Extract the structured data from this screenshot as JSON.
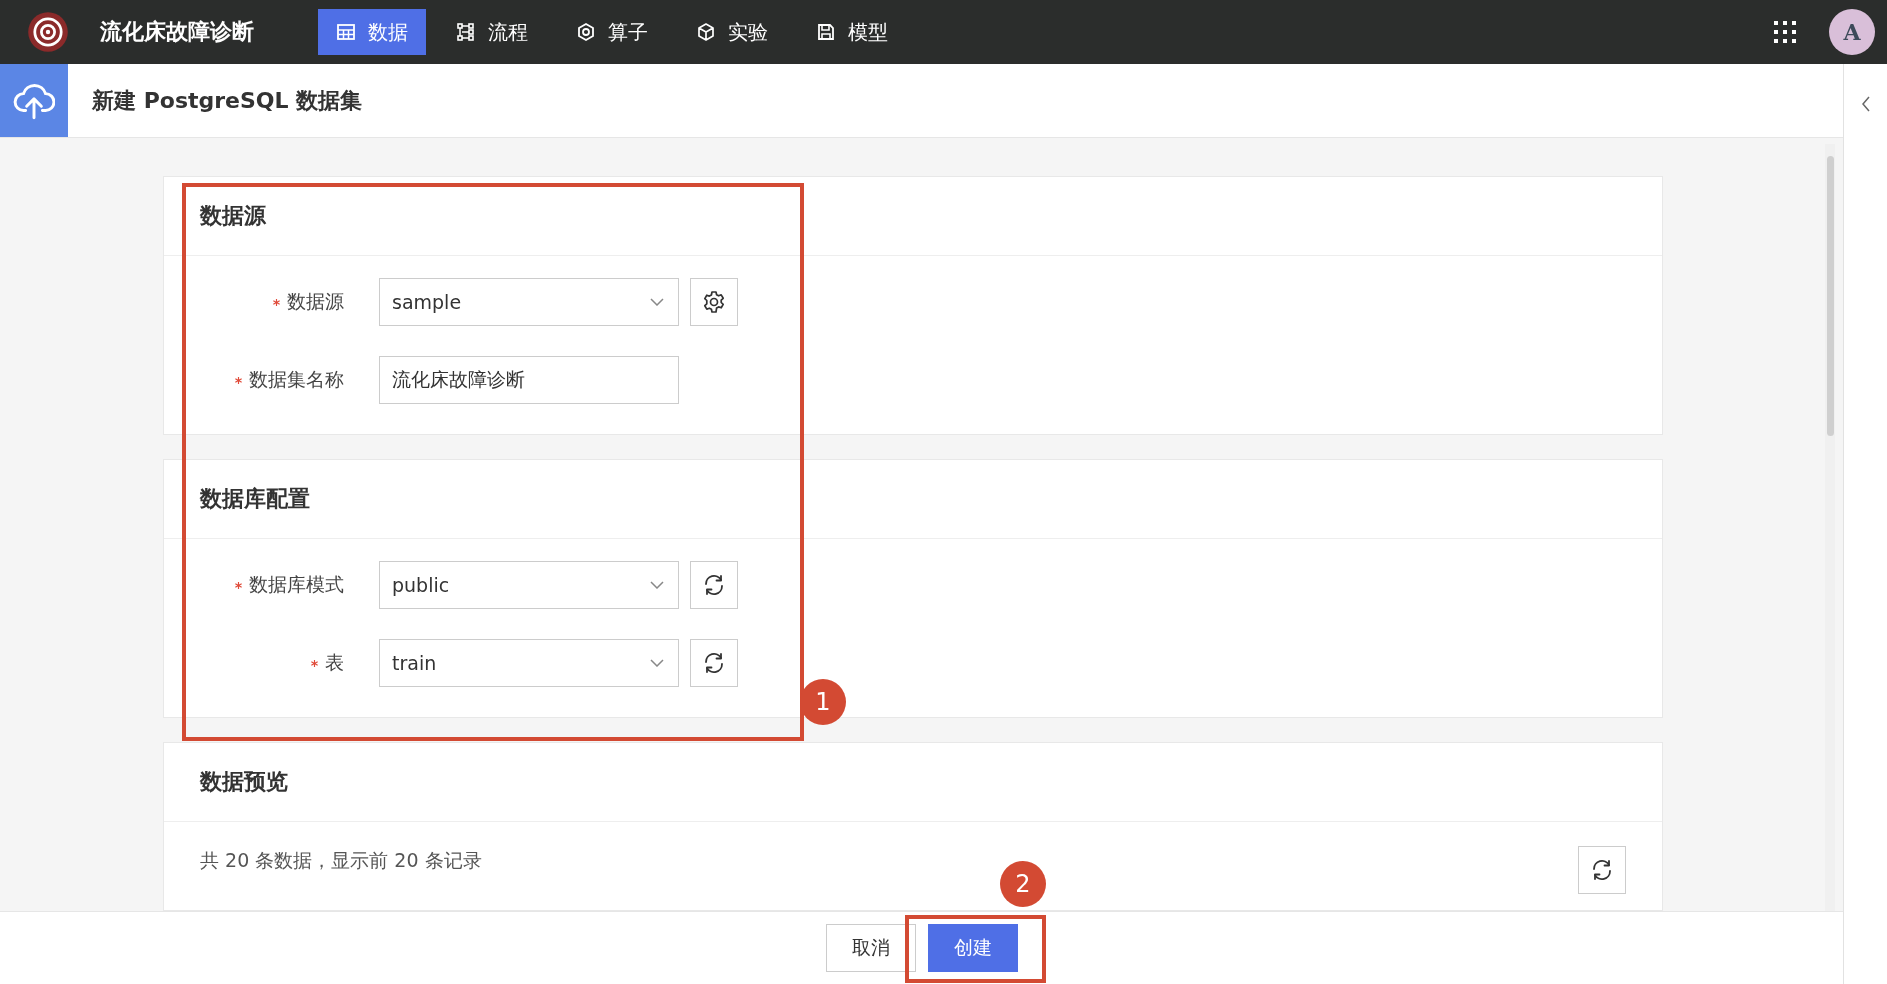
{
  "app": {
    "title": "流化床故障诊断",
    "avatar": "A",
    "nav": [
      {
        "label": "数据",
        "selected": true
      },
      {
        "label": "流程",
        "selected": false
      },
      {
        "label": "算子",
        "selected": false
      },
      {
        "label": "实验",
        "selected": false
      },
      {
        "label": "模型",
        "selected": false
      }
    ]
  },
  "page": {
    "title": "新建 PostgreSQL 数据集"
  },
  "sections": [
    {
      "title": "数据源",
      "fields": [
        {
          "label": "数据源",
          "required": true,
          "kind": "select",
          "value": "sample"
        },
        {
          "label": "数据集名称",
          "required": true,
          "kind": "text",
          "value": "流化床故障诊断"
        }
      ]
    },
    {
      "title": "数据库配置",
      "fields": [
        {
          "label": "数据库模式",
          "required": true,
          "kind": "select",
          "value": "public"
        },
        {
          "label": "表",
          "required": true,
          "kind": "select",
          "value": "train"
        }
      ]
    }
  ],
  "preview": {
    "title": "数据预览",
    "summary": "共 20 条数据，显示前 20 条记录"
  },
  "footer": {
    "buttons": [
      {
        "label": "取消",
        "kind": "default"
      },
      {
        "label": "创建",
        "kind": "primary"
      }
    ]
  },
  "annotations": [
    {
      "label": "1"
    },
    {
      "label": "2"
    }
  ]
}
